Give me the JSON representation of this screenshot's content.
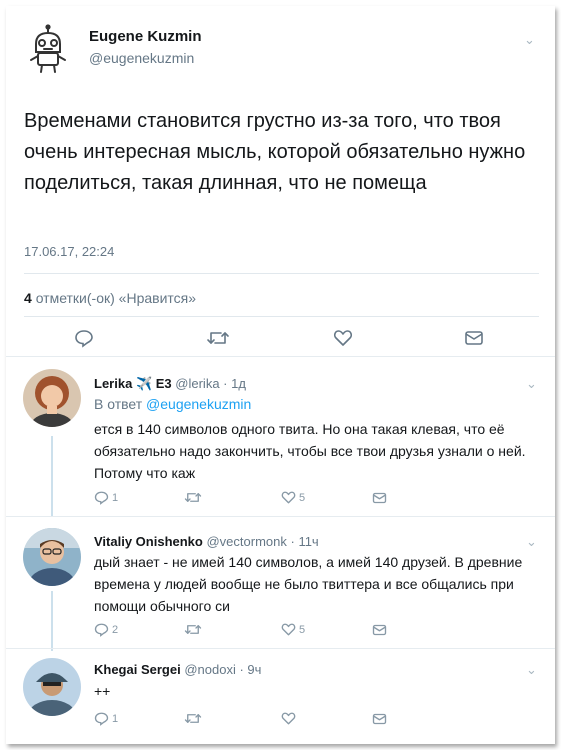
{
  "tweet": {
    "author_name": "Eugene Kuzmin",
    "author_handle": "@eugenekuzmin",
    "text": "Временами становится грустно из-за того, что твоя очень интересная мысль, которой обязательно нужно поделиться, такая длинная, что не помеща",
    "timestamp": "17.06.17, 22:24",
    "likes_count": "4",
    "likes_label": "отметки(-ок) «Нравится»"
  },
  "replies": [
    {
      "name": "Lerika",
      "emoji": "✈️",
      "suffix": "E3",
      "handle": "@lerika",
      "time": "1д",
      "reply_to_label": "В ответ",
      "reply_to_handle": "@eugenekuzmin",
      "text": "ется в 140 символов одного твита. Но она такая клевая, что её обязательно надо закончить, чтобы все твои друзья узнали о ней. Потому что каж",
      "reply_count": "1",
      "like_count": "5"
    },
    {
      "name": "Vitaliy Onishenko",
      "handle": "@vectormonk",
      "time": "11ч",
      "text": "дый знает - не имей 140 символов, а имей 140 друзей. В древние времена у людей вообще не было твиттера и все общались при помощи обычного си",
      "reply_count": "2",
      "like_count": "5"
    },
    {
      "name": "Khegai Sergei",
      "handle": "@nodoxi",
      "time": "9ч",
      "text": "++",
      "reply_count": "1",
      "like_count": ""
    }
  ],
  "separator": " · ",
  "icons": {
    "reply": "reply-icon",
    "retweet": "retweet-icon",
    "like": "heart-icon",
    "dm": "envelope-icon",
    "more": "chevron-down-icon"
  },
  "colors": {
    "link": "#1da1f2",
    "muted": "#657786",
    "icon": "#8899a6",
    "divider": "#e1e8ed"
  }
}
